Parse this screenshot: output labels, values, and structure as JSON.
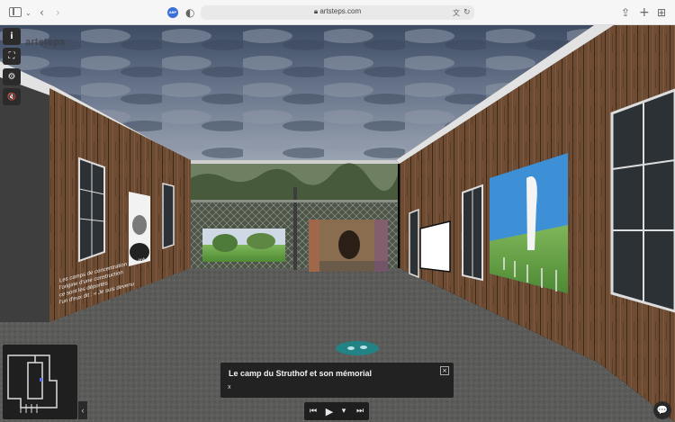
{
  "browser": {
    "url": "artsteps.com",
    "extension_badge": "ABP",
    "icons": [
      "sidebar-icon",
      "chevron-down-icon",
      "back-icon",
      "forward-icon",
      "shield-icon",
      "lock-icon",
      "translate-icon",
      "reload-icon",
      "share-icon",
      "new-tab-icon",
      "tabs-grid-icon"
    ]
  },
  "app": {
    "brand": "artsteps",
    "tools": [
      {
        "name": "info-button",
        "glyph": "i"
      },
      {
        "name": "fullscreen-button",
        "glyph": "⛶"
      },
      {
        "name": "settings-button",
        "glyph": "⚙"
      },
      {
        "name": "mute-button",
        "glyph": "🔇"
      }
    ]
  },
  "wall_text": {
    "lines": [
      "Les camps de concentration ont été",
      "l'origine d'une construction",
      "ce sont les déportés",
      "l'un d'eux dit : « Je suis devenu"
    ]
  },
  "caption": {
    "title": "Le camp du Struthof et son mémorial",
    "body": "x",
    "close_glyph": "×"
  },
  "controls": {
    "prev": "⏮",
    "play": "▶",
    "menu": "▾",
    "next": "⏭"
  },
  "minimap_collapse_glyph": "‹",
  "chat_glyph": "💬",
  "colors": {
    "wood": "#6b4a33",
    "floor": "#5a5a58",
    "sky": "#4b5a72",
    "ui_dark": "#222222"
  }
}
